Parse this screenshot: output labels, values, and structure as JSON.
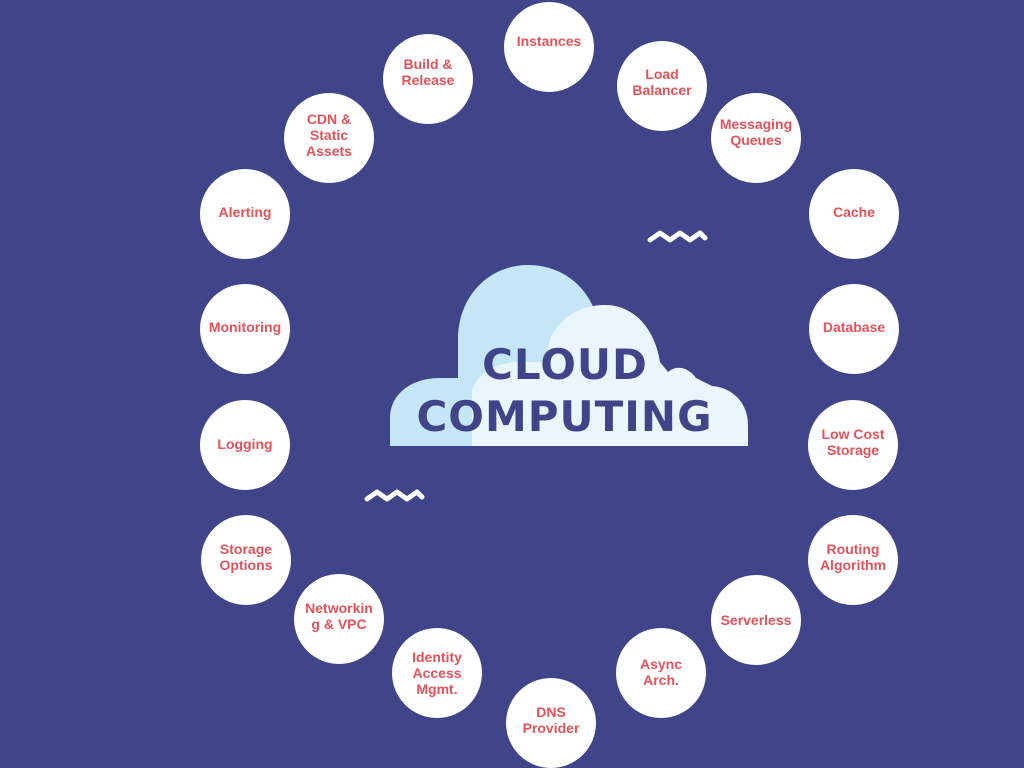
{
  "title": {
    "line1": "CLOUD",
    "line2": "COMPUTING"
  },
  "colors": {
    "background": "#40458a",
    "node_fill": "#ffffff",
    "node_text": "#e5525a",
    "cloud_back": "#c5e6f7",
    "cloud_front": "#eaf6fd",
    "title_text": "#40458a"
  },
  "nodes": [
    {
      "label": "Instances"
    },
    {
      "label": "Load\nBalancer"
    },
    {
      "label": "Messaging\nQueues"
    },
    {
      "label": "Cache"
    },
    {
      "label": "Database"
    },
    {
      "label": "Low Cost\nStorage"
    },
    {
      "label": "Routing\nAlgorithm"
    },
    {
      "label": "Serverless"
    },
    {
      "label": "Async\nArch."
    },
    {
      "label": "DNS\nProvider"
    },
    {
      "label": "Identity\nAccess\nMgmt."
    },
    {
      "label": "Networkin\ng & VPC"
    },
    {
      "label": "Storage\nOptions"
    },
    {
      "label": "Logging"
    },
    {
      "label": "Monitoring"
    },
    {
      "label": "Alerting"
    },
    {
      "label": "CDN &\nStatic\nAssets"
    },
    {
      "label": "Build &\nRelease"
    }
  ]
}
